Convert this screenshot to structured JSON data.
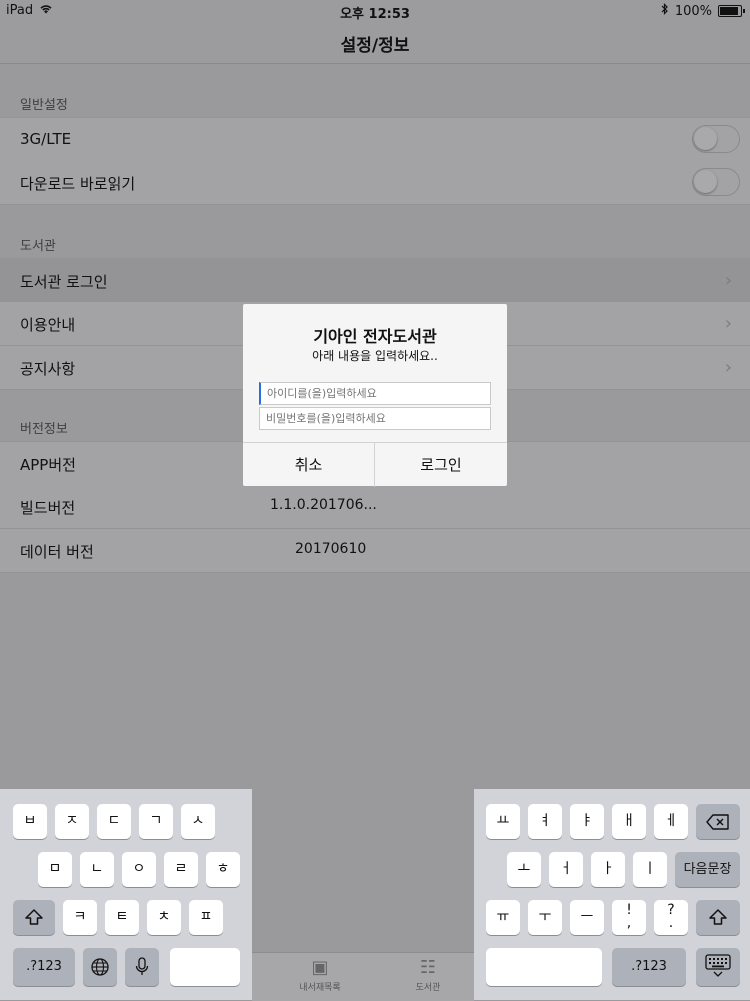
{
  "status_bar": {
    "device": "iPad",
    "time": "오후 12:53",
    "battery": "100%"
  },
  "nav": {
    "title": "설정/정보"
  },
  "sections": {
    "general": {
      "header": "일반설정",
      "rows": [
        {
          "label": "3G/LTE"
        },
        {
          "label": "다운로드 바로읽기"
        }
      ]
    },
    "library": {
      "header": "도서관",
      "rows": [
        {
          "label": "도서관 로그인"
        },
        {
          "label": "이용안내"
        },
        {
          "label": "공지사항"
        }
      ]
    },
    "version": {
      "header": "버전정보",
      "rows": [
        {
          "label": "APP버전",
          "value": ""
        },
        {
          "label": "빌드버전",
          "value": "1.1.0.201706..."
        },
        {
          "label": "데이터 버전",
          "value": "20170610"
        }
      ]
    }
  },
  "dialog": {
    "title": "기아인 전자도서관",
    "message": "아래 내용을 입력하세요..",
    "id_placeholder": "아이디를(을)입력하세요",
    "pw_placeholder": "비밀번호를(을)입력하세요",
    "cancel": "취소",
    "login": "로그인"
  },
  "tab_bar": {
    "items": [
      {
        "label": "내서재목록",
        "icon": "book-icon"
      },
      {
        "label": "도서관",
        "icon": "library-icon"
      }
    ]
  },
  "keyboard": {
    "left_row1": [
      "ㅂ",
      "ㅈ",
      "ㄷ",
      "ㄱ",
      "ㅅ"
    ],
    "left_row2": [
      "ㅁ",
      "ㄴ",
      "ㅇ",
      "ㄹ",
      "ㅎ"
    ],
    "left_row3": [
      "ㅋ",
      "ㅌ",
      "ㅊ",
      "ㅍ"
    ],
    "right_row1": [
      "ㅛ",
      "ㅕ",
      "ㅑ",
      "ㅐ",
      "ㅔ"
    ],
    "right_row2": [
      "ㅗ",
      "ㅓ",
      "ㅏ",
      "ㅣ"
    ],
    "right_row3": [
      "ㅠ",
      "ㅜ",
      "ㅡ",
      "!\n,",
      "?\n."
    ],
    "numbers_key": ".?123",
    "return_key": "다음문장"
  }
}
